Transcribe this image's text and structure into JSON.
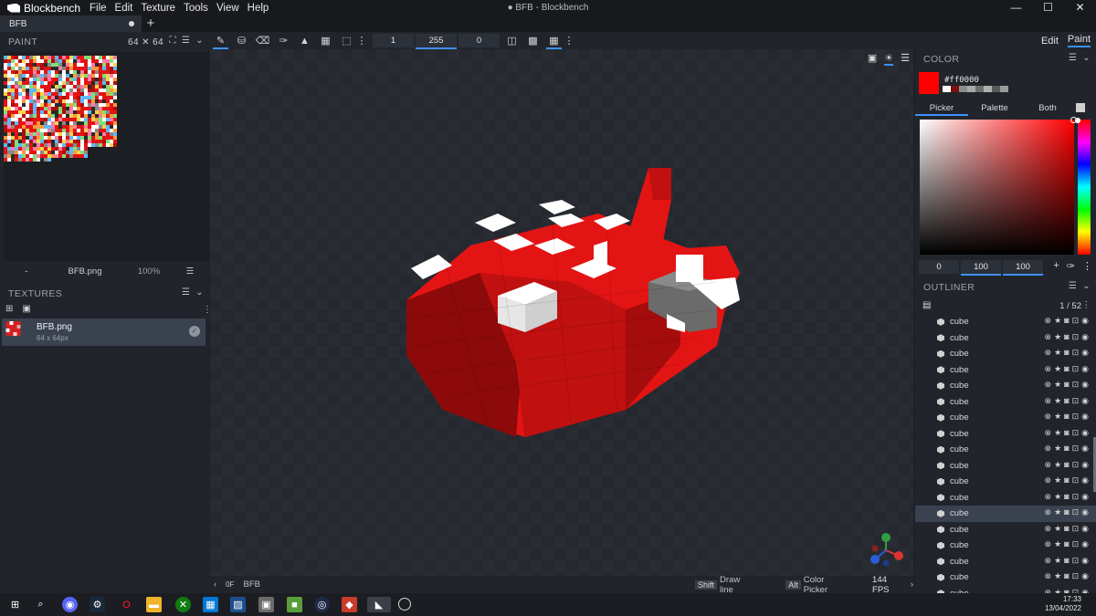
{
  "app": {
    "name": "Blockbench",
    "window_title": "● BFB - Blockbench"
  },
  "menu": [
    "File",
    "Edit",
    "Texture",
    "Tools",
    "View",
    "Help"
  ],
  "window_controls": [
    "—",
    "☐",
    "✕"
  ],
  "tabs": [
    {
      "label": "BFB",
      "unsaved": true
    }
  ],
  "toolbar": {
    "brush_size": "1",
    "opacity": "255",
    "softness": "0"
  },
  "modes": {
    "edit": "Edit",
    "paint": "Paint",
    "active": "Paint"
  },
  "paint_panel": {
    "title": "PAINT",
    "size_label": "64 ✕ 64",
    "file_label": "BFB.png",
    "zoom": "100%",
    "left_label": "-"
  },
  "textures_panel": {
    "title": "TEXTURES",
    "item": {
      "name": "BFB.png",
      "resolution": "64 x 64px"
    }
  },
  "color_panel": {
    "title": "COLOR",
    "hex": "#ff0000",
    "current_color": "#ff0000",
    "tabs": [
      "Picker",
      "Palette",
      "Both"
    ],
    "active_tab": "Picker",
    "hsv": [
      "0",
      "100",
      "100"
    ],
    "history": [
      "#ffffff",
      "#7a1010",
      "#8c8c8c",
      "#a8a8a8",
      "#6e6e6e",
      "#b0b0b0",
      "#5a5a5a",
      "#9a9a9a"
    ]
  },
  "outliner": {
    "title": "OUTLINER",
    "count": "1 / 52",
    "items": [
      "cube",
      "cube",
      "cube",
      "cube",
      "cube",
      "cube",
      "cube",
      "cube",
      "cube",
      "cube",
      "cube",
      "cube",
      "cube",
      "cube",
      "cube",
      "cube",
      "cube",
      "cube"
    ],
    "selected_index": 12
  },
  "statusbar": {
    "model_name": "BFB",
    "hint1_key": "Shift",
    "hint1": "Draw line",
    "hint2_key": "Alt",
    "hint2": "Color Picker",
    "fps": "144 FPS"
  },
  "clock": {
    "time": "17:33",
    "date": "13/04/2022"
  }
}
